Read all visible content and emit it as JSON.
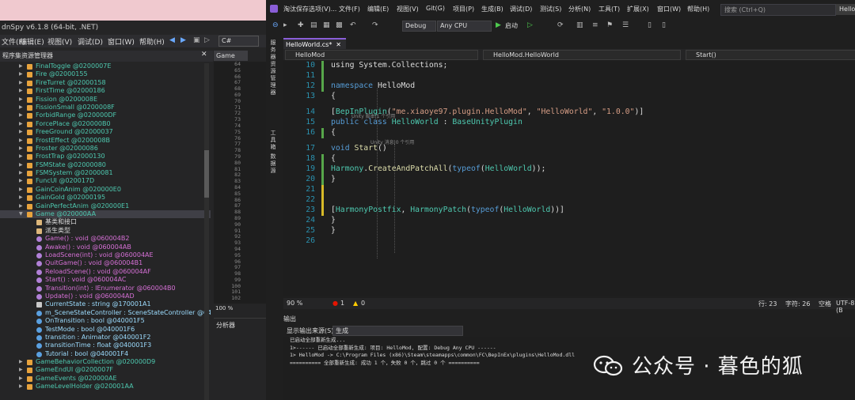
{
  "dnspy": {
    "title": "dnSpy v6.1.8 (64-bit, .NET)",
    "menu": [
      "文件(F)",
      "编辑(E)",
      "视图(V)",
      "调试(D)",
      "窗口(W)",
      "帮助(H)"
    ],
    "language": "C#",
    "tree_header": "程序集资源管理器",
    "tree_items": [
      {
        "label": "FinalToggle @0200007E",
        "indent": 1,
        "icon": "class",
        "color": "#4ec9b0"
      },
      {
        "label": "Fire @02000155",
        "indent": 1,
        "icon": "class",
        "color": "#4ec9b0"
      },
      {
        "label": "FireTurret @02000158",
        "indent": 1,
        "icon": "class",
        "color": "#4ec9b0"
      },
      {
        "label": "FirstTime @02000186",
        "indent": 1,
        "icon": "class",
        "color": "#4ec9b0"
      },
      {
        "label": "Fission @0200008E",
        "indent": 1,
        "icon": "class",
        "color": "#4ec9b0"
      },
      {
        "label": "FissionSmall @0200008F",
        "indent": 1,
        "icon": "class",
        "color": "#4ec9b0"
      },
      {
        "label": "ForbidRange @020000DF",
        "indent": 1,
        "icon": "class",
        "color": "#4ec9b0"
      },
      {
        "label": "ForcePlace @020000B0",
        "indent": 1,
        "icon": "class",
        "color": "#4ec9b0"
      },
      {
        "label": "FreeGround @02000037",
        "indent": 1,
        "icon": "class",
        "color": "#4ec9b0"
      },
      {
        "label": "FrostEffect @0200008B",
        "indent": 1,
        "icon": "class",
        "color": "#4ec9b0"
      },
      {
        "label": "Froster @02000086",
        "indent": 1,
        "icon": "class",
        "color": "#4ec9b0"
      },
      {
        "label": "FrostTrap @02000130",
        "indent": 1,
        "icon": "class",
        "color": "#4ec9b0"
      },
      {
        "label": "FSMState @02000080",
        "indent": 1,
        "icon": "class",
        "color": "#4ec9b0"
      },
      {
        "label": "FSMSystem @02000081",
        "indent": 1,
        "icon": "class",
        "color": "#4ec9b0"
      },
      {
        "label": "FuncUI @020017D",
        "indent": 1,
        "icon": "class",
        "color": "#4ec9b0"
      },
      {
        "label": "GainCoinAnim @020000E0",
        "indent": 1,
        "icon": "class",
        "color": "#4ec9b0"
      },
      {
        "label": "GainGold @02000195",
        "indent": 1,
        "icon": "class",
        "color": "#4ec9b0"
      },
      {
        "label": "GainPerfectAnim @020000E1",
        "indent": 1,
        "icon": "class",
        "color": "#4ec9b0"
      },
      {
        "label": "Game @020000AA",
        "indent": 1,
        "icon": "class",
        "color": "#4ec9b0",
        "expanded": true,
        "selected": true
      },
      {
        "label": "基类和接口",
        "indent": 2,
        "icon": "folder",
        "color": "#dcdcdc"
      },
      {
        "label": "派生类型",
        "indent": 2,
        "icon": "folder",
        "color": "#dcdcdc"
      },
      {
        "label": "Game() : void @060004B2",
        "indent": 2,
        "icon": "method",
        "color": "#d670d6"
      },
      {
        "label": "Awake() : void @060004AB",
        "indent": 2,
        "icon": "method",
        "color": "#d670d6"
      },
      {
        "label": "LoadScene(int) : void @060004AE",
        "indent": 2,
        "icon": "method",
        "color": "#d670d6"
      },
      {
        "label": "QuitGame() : void @060004B1",
        "indent": 2,
        "icon": "method",
        "color": "#d670d6"
      },
      {
        "label": "ReloadScene() : void @060004AF",
        "indent": 2,
        "icon": "method",
        "color": "#d670d6"
      },
      {
        "label": "Start() : void @060004AC",
        "indent": 2,
        "icon": "method",
        "color": "#d670d6"
      },
      {
        "label": "Transition(int) : IEnumerator @060004B0",
        "indent": 2,
        "icon": "method",
        "color": "#d670d6"
      },
      {
        "label": "Update() : void @060004AD",
        "indent": 2,
        "icon": "method",
        "color": "#d670d6"
      },
      {
        "label": "CurrentState : string @170001A1",
        "indent": 2,
        "icon": "property",
        "color": "#9cdcfe"
      },
      {
        "label": "m_SceneStateController : SceneStateController @04000",
        "indent": 2,
        "icon": "field",
        "color": "#9cdcfe"
      },
      {
        "label": "OnTransition : bool @040001F5",
        "indent": 2,
        "icon": "field",
        "color": "#9cdcfe"
      },
      {
        "label": "TestMode : bool @040001F6",
        "indent": 2,
        "icon": "field",
        "color": "#9cdcfe"
      },
      {
        "label": "transition : Animator @040001F2",
        "indent": 2,
        "icon": "field",
        "color": "#9cdcfe"
      },
      {
        "label": "transitionTime : float @040001F3",
        "indent": 2,
        "icon": "field",
        "color": "#9cdcfe"
      },
      {
        "label": "Tutorial : bool @040001F4",
        "indent": 2,
        "icon": "field",
        "color": "#9cdcfe"
      },
      {
        "label": "GameBehaviorCollection @020000D9",
        "indent": 1,
        "icon": "class",
        "color": "#4ec9b0"
      },
      {
        "label": "GameEndUI @0200007F",
        "indent": 1,
        "icon": "class",
        "color": "#4ec9b0"
      },
      {
        "label": "GameEvents @020000AE",
        "indent": 1,
        "icon": "class",
        "color": "#4ec9b0"
      },
      {
        "label": "GameLevelHolder @020001AA",
        "indent": 1,
        "icon": "class",
        "color": "#4ec9b0"
      }
    ],
    "doc_tab": "Game",
    "line_numbers": [
      "64",
      "65",
      "66",
      "67",
      "68",
      "69",
      "70",
      "71",
      "72",
      "73",
      "74",
      "75",
      "76",
      "77",
      "78",
      "79",
      "80",
      "81",
      "82",
      "83",
      "84",
      "85",
      "86",
      "87",
      "88",
      "89",
      "90",
      "91",
      "92",
      "93",
      "94",
      "95",
      "96",
      "97",
      "98",
      "99",
      "100",
      "101",
      "102"
    ],
    "zoom": "100 %",
    "analyzer_title": "分析器"
  },
  "vs": {
    "menu": [
      "淘汰保存选项(V)...",
      "文件(F)",
      "编辑(E)",
      "视图(V)",
      "Git(G)",
      "项目(P)",
      "生成(B)",
      "调试(D)",
      "测试(S)",
      "分析(N)",
      "工具(T)",
      "扩展(X)",
      "窗口(W)",
      "帮助(H)"
    ],
    "search_placeholder": "搜索 (Ctrl+Q)",
    "window_button": "Hello",
    "config": "Debug",
    "platform": "Any CPU",
    "start_label": "启动",
    "side_tools": [
      "服务器资源管理器",
      "工具箱",
      "数据源"
    ],
    "doc_tab": "HelloWorld.cs*",
    "nav": {
      "project": "HelloMod",
      "type": "HelloMod.HelloWorld",
      "member": "Start()"
    },
    "code_lines": [
      {
        "num": "10",
        "bar": "#57a64a",
        "parts": [
          [
            "pl",
            "using System.Collections;"
          ]
        ]
      },
      {
        "num": "11",
        "bar": "#57a64a",
        "parts": []
      },
      {
        "num": "12",
        "bar": "#57a64a",
        "parts": [
          [
            "kw",
            "namespace "
          ],
          [
            "pl",
            "HelloMod"
          ]
        ]
      },
      {
        "num": "13",
        "bar": "",
        "parts": [
          [
            "pl",
            "  {"
          ]
        ]
      },
      {
        "num": "14",
        "bar": "",
        "parts": [
          [
            "pl",
            "    ["
          ],
          [
            "ty",
            "BepInPlugin"
          ],
          [
            "pl",
            "("
          ],
          [
            "st",
            "\"me.xiaoye97.plugin.HelloMod\""
          ],
          [
            "pl",
            ", "
          ],
          [
            "st",
            "\"HelloWorld\""
          ],
          [
            "pl",
            ", "
          ],
          [
            "st",
            "\"1.0.0\""
          ],
          [
            "pl",
            ")]"
          ]
        ]
      },
      {
        "num": "15",
        "bar": "",
        "hint": "Unity 脚本|1 个引用",
        "parts": [
          [
            "pl",
            "    "
          ],
          [
            "kw",
            "public class "
          ],
          [
            "ty",
            "HelloWorld"
          ],
          [
            "pl",
            " : "
          ],
          [
            "ty",
            "BaseUnityPlugin"
          ]
        ]
      },
      {
        "num": "16",
        "bar": "#57a64a",
        "parts": [
          [
            "pl",
            "    {"
          ]
        ]
      },
      {
        "num": "17",
        "bar": "",
        "hint": "Unity 消息|0 个引用",
        "parts": [
          [
            "pl",
            "        "
          ],
          [
            "kw",
            "void "
          ],
          [
            "mt",
            "Start"
          ],
          [
            "pl",
            "()"
          ]
        ]
      },
      {
        "num": "18",
        "bar": "#57a64a",
        "parts": [
          [
            "pl",
            "        {"
          ]
        ]
      },
      {
        "num": "19",
        "bar": "#57a64a",
        "parts": [
          [
            "pl",
            "           "
          ],
          [
            "ty",
            "Harmony"
          ],
          [
            "pl",
            "."
          ],
          [
            "mt",
            "CreateAndPatchAll"
          ],
          [
            "pl",
            "("
          ],
          [
            "kw",
            "typeof"
          ],
          [
            "pl",
            "("
          ],
          [
            "ty",
            "HelloWorld"
          ],
          [
            "pl",
            "));"
          ]
        ]
      },
      {
        "num": "20",
        "bar": "#57a64a",
        "parts": [
          [
            "pl",
            "        }"
          ]
        ]
      },
      {
        "num": "21",
        "bar": "#d7ba28",
        "parts": []
      },
      {
        "num": "22",
        "bar": "#d7ba28",
        "parts": []
      },
      {
        "num": "23",
        "bar": "#d7ba28",
        "parts": [
          [
            "pl",
            "        ["
          ],
          [
            "ty",
            "HarmonyPostfix"
          ],
          [
            "pl",
            ", "
          ],
          [
            "ty",
            "HarmonyPatch"
          ],
          [
            "pl",
            "("
          ],
          [
            "kw",
            "typeof"
          ],
          [
            "pl",
            "("
          ],
          [
            "ty",
            "HelloWorld"
          ],
          [
            "pl",
            "))]"
          ]
        ]
      },
      {
        "num": "24",
        "bar": "",
        "parts": [
          [
            "pl",
            "    }"
          ]
        ]
      },
      {
        "num": "25",
        "bar": "",
        "parts": [
          [
            "pl",
            "}"
          ]
        ]
      },
      {
        "num": "26",
        "bar": "",
        "parts": []
      }
    ],
    "status": {
      "zoom": "90 %",
      "errors": "1",
      "warnings": "0",
      "line": "行: 23",
      "col": "字符: 26",
      "mode": "空格",
      "encoding": "UTF-8 (B"
    },
    "output_title": "输出",
    "output_source_label": "显示输出来源(S):",
    "output_source_value": "生成",
    "output_lines": [
      "已启动全部重新生成...",
      "1>------ 已启动全部重新生成: 项目: HelloMod, 配置: Debug Any CPU ------",
      "1>  HelloMod -> C:\\Program Files (x86)\\Steam\\steamapps\\common\\FC\\BepInEx\\plugins\\HelloMod.dll",
      "========== 全部重新生成: 成功 1 个，失败 0 个，跳过 0 个 =========="
    ]
  },
  "watermark": {
    "text": "公众号 · 暮色的狐"
  }
}
